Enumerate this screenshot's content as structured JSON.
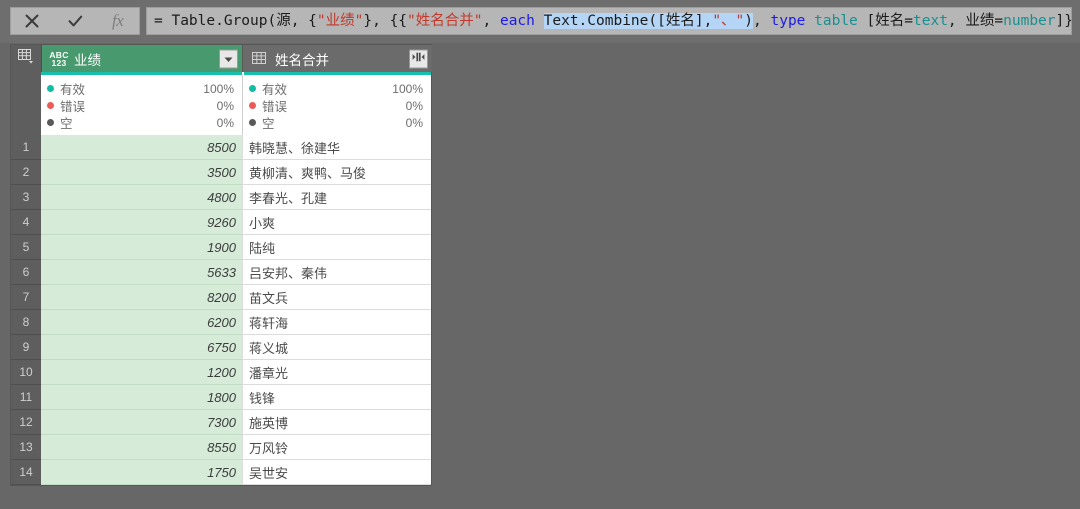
{
  "formula_bar": {
    "cancel_icon": "close-icon",
    "confirm_icon": "check-icon",
    "fx_label": "fx",
    "formula_plain": "= Table.Group(源, {\"业绩\"}, {{\"姓名合并\", each Text.Combine([姓名],\"、\"), type table [姓名=text, 业绩=number]}})",
    "tokens": [
      {
        "t": "= Table.Group(源, {",
        "c": "plain"
      },
      {
        "t": "\"业绩\"",
        "c": "str"
      },
      {
        "t": "}, {{",
        "c": "plain"
      },
      {
        "t": "\"姓名合并\"",
        "c": "str"
      },
      {
        "t": ", ",
        "c": "plain"
      },
      {
        "t": "each",
        "c": "kw"
      },
      {
        "t": " ",
        "c": "plain"
      },
      {
        "t": "Text.Combine([姓名],",
        "c": "sel-plain"
      },
      {
        "t": "\"、\"",
        "c": "sel-str"
      },
      {
        "t": ")",
        "c": "sel-plain"
      },
      {
        "t": ", ",
        "c": "plain"
      },
      {
        "t": "type",
        "c": "kw"
      },
      {
        "t": " ",
        "c": "plain"
      },
      {
        "t": "table",
        "c": "type"
      },
      {
        "t": " [姓名=",
        "c": "plain"
      },
      {
        "t": "text",
        "c": "type"
      },
      {
        "t": ", 业绩=",
        "c": "plain"
      },
      {
        "t": "number",
        "c": "type"
      },
      {
        "t": "]}})",
        "c": "plain"
      }
    ]
  },
  "grid": {
    "corner_icon": "table-menu-icon",
    "columns": [
      {
        "name": "业绩",
        "type_icon": "abc123-icon",
        "type_icon_top": "ABC",
        "type_icon_bottom": "123",
        "selected": true,
        "button_icon": "chevron-down-icon"
      },
      {
        "name": "姓名合并",
        "type_icon": "table-icon",
        "selected": false,
        "button_icon": "expand-columns-icon"
      }
    ],
    "quality": [
      {
        "column": "业绩",
        "stats": [
          {
            "label": "有效",
            "value": "100%",
            "color": "#16b9a3"
          },
          {
            "label": "错误",
            "value": "0%",
            "color": "#ec5b56"
          },
          {
            "label": "空",
            "value": "0%",
            "color": "#595959"
          }
        ]
      },
      {
        "column": "姓名合并",
        "stats": [
          {
            "label": "有效",
            "value": "100%",
            "color": "#16b9a3"
          },
          {
            "label": "错误",
            "value": "0%",
            "color": "#ec5b56"
          },
          {
            "label": "空",
            "value": "0%",
            "color": "#595959"
          }
        ]
      }
    ],
    "rows": [
      {
        "n": "1",
        "业绩": "8500",
        "姓名合并": "韩晓慧、徐建华"
      },
      {
        "n": "2",
        "业绩": "3500",
        "姓名合并": "黄柳清、爽鸭、马俊"
      },
      {
        "n": "3",
        "业绩": "4800",
        "姓名合并": "李春光、孔建"
      },
      {
        "n": "4",
        "业绩": "9260",
        "姓名合并": "小爽"
      },
      {
        "n": "5",
        "业绩": "1900",
        "姓名合并": "陆纯"
      },
      {
        "n": "6",
        "业绩": "5633",
        "姓名合并": "吕安邦、秦伟"
      },
      {
        "n": "7",
        "业绩": "8200",
        "姓名合并": "苗文兵"
      },
      {
        "n": "8",
        "业绩": "6200",
        "姓名合并": "蒋轩海"
      },
      {
        "n": "9",
        "业绩": "6750",
        "姓名合并": "蒋义城"
      },
      {
        "n": "10",
        "业绩": "1200",
        "姓名合并": "潘章光"
      },
      {
        "n": "11",
        "业绩": "1800",
        "姓名合并": "钱锋"
      },
      {
        "n": "12",
        "业绩": "7300",
        "姓名合并": "施英博"
      },
      {
        "n": "13",
        "业绩": "8550",
        "姓名合并": "万风铃"
      },
      {
        "n": "14",
        "业绩": "1750",
        "姓名合并": "吴世安"
      }
    ]
  },
  "colors": {
    "header_selected": "#489a6e",
    "header_unselected": "#6b6b6b",
    "teal_accent": "#17c0ad",
    "value_column_bg": "#d6ecd9",
    "app_background": "#676767",
    "formula_selection": "#b4d5f5"
  }
}
